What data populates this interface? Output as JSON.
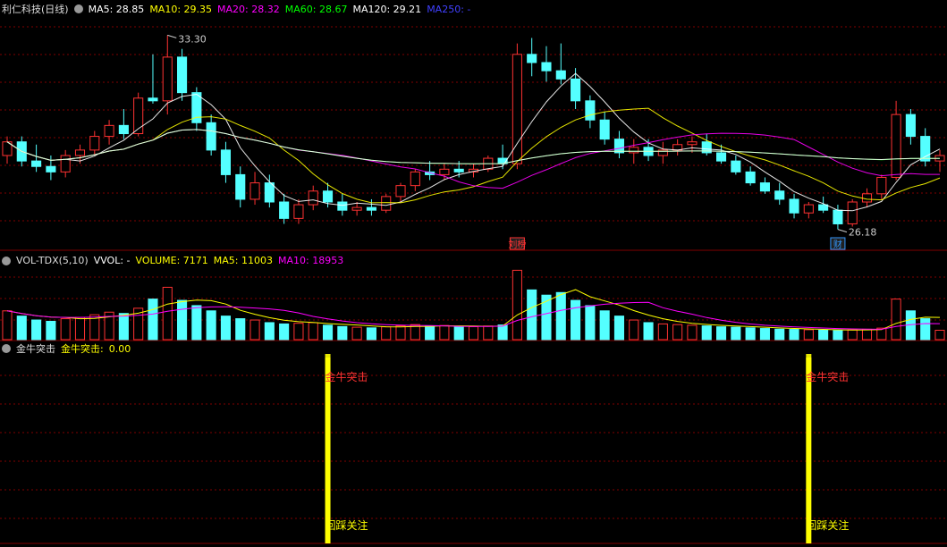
{
  "colors": {
    "up": "#ff3232",
    "down": "#54ffff",
    "ma5": "#ffffff",
    "ma10": "#ffff00",
    "ma20": "#ff00ff",
    "ma60": "#00ff00",
    "ma120": "#ffffff",
    "ma250": "#4040ff",
    "vol_ma5": "#ffff00",
    "vol_ma10": "#ff00ff",
    "bar": "#ffff00",
    "grid": "#800000"
  },
  "price_panel": {
    "title": "利仁科技(日线)",
    "ma_labels": [
      {
        "label": "MA5:",
        "value": "28.85",
        "color": "#ffffff"
      },
      {
        "label": "MA10:",
        "value": "29.35",
        "color": "#ffff00"
      },
      {
        "label": "MA20:",
        "value": "28.32",
        "color": "#ff00ff"
      },
      {
        "label": "MA60:",
        "value": "28.67",
        "color": "#00ff00"
      },
      {
        "label": "MA120:",
        "value": "29.21",
        "color": "#ffffff"
      },
      {
        "label": "MA250:",
        "value": "-",
        "color": "#4040ff"
      }
    ],
    "high_label": "33.30",
    "low_label": "26.18",
    "markers": [
      "刘榜",
      "财"
    ]
  },
  "volume_panel": {
    "title": "VOL-TDX(5,10)",
    "labels": [
      {
        "label": "VVOL:",
        "value": "-",
        "color": "#ffffff"
      },
      {
        "label": "VOLUME:",
        "value": "7171",
        "color": "#ffff00"
      },
      {
        "label": "MA5:",
        "value": "11003",
        "color": "#ffff00"
      },
      {
        "label": "MA10:",
        "value": "18953",
        "color": "#ff00ff"
      }
    ]
  },
  "signal_panel": {
    "title": "金牛突击",
    "label": "金牛突击:",
    "value": "0.00",
    "top_text": "金牛突击",
    "bottom_text": "回踩关注"
  },
  "chart_data": [
    {
      "type": "candlestick",
      "title": "利仁科技(日线)",
      "ylim": [
        25.5,
        34.0
      ],
      "candles": [
        {
          "o": 28.9,
          "h": 29.6,
          "l": 28.6,
          "c": 29.4
        },
        {
          "o": 29.4,
          "h": 29.6,
          "l": 28.5,
          "c": 28.7
        },
        {
          "o": 28.7,
          "h": 29.3,
          "l": 28.3,
          "c": 28.5
        },
        {
          "o": 28.5,
          "h": 28.9,
          "l": 28.0,
          "c": 28.3
        },
        {
          "o": 28.3,
          "h": 29.1,
          "l": 28.1,
          "c": 28.9
        },
        {
          "o": 28.9,
          "h": 29.3,
          "l": 28.6,
          "c": 29.1
        },
        {
          "o": 29.1,
          "h": 29.8,
          "l": 28.9,
          "c": 29.6
        },
        {
          "o": 29.6,
          "h": 30.2,
          "l": 29.3,
          "c": 30.0
        },
        {
          "o": 30.0,
          "h": 30.6,
          "l": 29.5,
          "c": 29.7
        },
        {
          "o": 29.7,
          "h": 31.2,
          "l": 29.6,
          "c": 31.0
        },
        {
          "o": 31.0,
          "h": 32.6,
          "l": 30.8,
          "c": 30.9
        },
        {
          "o": 30.9,
          "h": 33.3,
          "l": 30.4,
          "c": 32.5
        },
        {
          "o": 32.5,
          "h": 32.8,
          "l": 30.9,
          "c": 31.2
        },
        {
          "o": 31.2,
          "h": 31.4,
          "l": 29.8,
          "c": 30.1
        },
        {
          "o": 30.1,
          "h": 30.4,
          "l": 28.9,
          "c": 29.1
        },
        {
          "o": 29.1,
          "h": 29.4,
          "l": 27.9,
          "c": 28.2
        },
        {
          "o": 28.2,
          "h": 28.5,
          "l": 27.0,
          "c": 27.3
        },
        {
          "o": 27.3,
          "h": 28.3,
          "l": 27.1,
          "c": 27.9
        },
        {
          "o": 27.9,
          "h": 28.2,
          "l": 27.0,
          "c": 27.2
        },
        {
          "o": 27.2,
          "h": 27.5,
          "l": 26.4,
          "c": 26.6
        },
        {
          "o": 26.6,
          "h": 27.3,
          "l": 26.4,
          "c": 27.1
        },
        {
          "o": 27.1,
          "h": 27.8,
          "l": 26.9,
          "c": 27.6
        },
        {
          "o": 27.6,
          "h": 27.9,
          "l": 27.0,
          "c": 27.2
        },
        {
          "o": 27.2,
          "h": 27.5,
          "l": 26.7,
          "c": 26.9
        },
        {
          "o": 26.9,
          "h": 27.2,
          "l": 26.7,
          "c": 27.0
        },
        {
          "o": 27.0,
          "h": 27.3,
          "l": 26.7,
          "c": 26.9
        },
        {
          "o": 26.9,
          "h": 27.5,
          "l": 26.8,
          "c": 27.4
        },
        {
          "o": 27.4,
          "h": 27.9,
          "l": 27.2,
          "c": 27.8
        },
        {
          "o": 27.8,
          "h": 28.4,
          "l": 27.6,
          "c": 28.3
        },
        {
          "o": 28.3,
          "h": 28.7,
          "l": 28.0,
          "c": 28.2
        },
        {
          "o": 28.2,
          "h": 28.6,
          "l": 28.0,
          "c": 28.4
        },
        {
          "o": 28.4,
          "h": 28.7,
          "l": 28.1,
          "c": 28.3
        },
        {
          "o": 28.3,
          "h": 28.6,
          "l": 28.1,
          "c": 28.4
        },
        {
          "o": 28.4,
          "h": 28.9,
          "l": 28.3,
          "c": 28.8
        },
        {
          "o": 28.8,
          "h": 29.3,
          "l": 28.4,
          "c": 28.6
        },
        {
          "o": 28.6,
          "h": 33.0,
          "l": 28.4,
          "c": 32.6
        },
        {
          "o": 32.6,
          "h": 33.2,
          "l": 31.8,
          "c": 32.3
        },
        {
          "o": 32.3,
          "h": 32.9,
          "l": 31.6,
          "c": 32.0
        },
        {
          "o": 32.0,
          "h": 33.0,
          "l": 31.5,
          "c": 31.7
        },
        {
          "o": 31.7,
          "h": 32.1,
          "l": 30.6,
          "c": 30.9
        },
        {
          "o": 30.9,
          "h": 31.1,
          "l": 29.9,
          "c": 30.2
        },
        {
          "o": 30.2,
          "h": 30.5,
          "l": 29.3,
          "c": 29.5
        },
        {
          "o": 29.5,
          "h": 29.8,
          "l": 28.8,
          "c": 29.0
        },
        {
          "o": 29.0,
          "h": 29.5,
          "l": 28.6,
          "c": 29.2
        },
        {
          "o": 29.2,
          "h": 29.5,
          "l": 28.7,
          "c": 28.9
        },
        {
          "o": 28.9,
          "h": 29.4,
          "l": 28.6,
          "c": 29.1
        },
        {
          "o": 29.1,
          "h": 29.5,
          "l": 28.9,
          "c": 29.3
        },
        {
          "o": 29.3,
          "h": 29.6,
          "l": 29.0,
          "c": 29.4
        },
        {
          "o": 29.4,
          "h": 29.7,
          "l": 28.9,
          "c": 29.0
        },
        {
          "o": 29.0,
          "h": 29.3,
          "l": 28.6,
          "c": 28.7
        },
        {
          "o": 28.7,
          "h": 28.9,
          "l": 28.2,
          "c": 28.3
        },
        {
          "o": 28.3,
          "h": 28.5,
          "l": 27.8,
          "c": 27.9
        },
        {
          "o": 27.9,
          "h": 28.1,
          "l": 27.5,
          "c": 27.6
        },
        {
          "o": 27.6,
          "h": 27.9,
          "l": 27.1,
          "c": 27.3
        },
        {
          "o": 27.3,
          "h": 27.5,
          "l": 26.6,
          "c": 26.8
        },
        {
          "o": 26.8,
          "h": 27.2,
          "l": 26.6,
          "c": 27.1
        },
        {
          "o": 27.1,
          "h": 27.4,
          "l": 26.8,
          "c": 26.9
        },
        {
          "o": 26.9,
          "h": 27.1,
          "l": 26.2,
          "c": 26.4
        },
        {
          "o": 26.4,
          "h": 27.3,
          "l": 26.3,
          "c": 27.2
        },
        {
          "o": 27.2,
          "h": 27.7,
          "l": 27.0,
          "c": 27.5
        },
        {
          "o": 27.5,
          "h": 28.2,
          "l": 27.3,
          "c": 28.1
        },
        {
          "o": 28.1,
          "h": 30.9,
          "l": 28.0,
          "c": 30.4
        },
        {
          "o": 30.4,
          "h": 30.6,
          "l": 29.3,
          "c": 29.6
        },
        {
          "o": 29.6,
          "h": 29.9,
          "l": 28.5,
          "c": 28.7
        },
        {
          "o": 28.7,
          "h": 29.1,
          "l": 28.3,
          "c": 28.9
        }
      ]
    },
    {
      "type": "bar",
      "title": "VOL-TDX(5,10)",
      "series": [
        {
          "name": "VOLUME",
          "values": [
            22000,
            18000,
            15000,
            14000,
            16000,
            17000,
            19000,
            21000,
            20000,
            24000,
            31000,
            40000,
            30000,
            26000,
            22000,
            18000,
            16000,
            15000,
            13000,
            12000,
            12500,
            13000,
            11000,
            10000,
            9500,
            9000,
            9800,
            10500,
            11500,
            10200,
            10800,
            9600,
            9900,
            10400,
            11200,
            53000,
            38000,
            34000,
            36000,
            30000,
            26000,
            22000,
            18000,
            15000,
            13000,
            12000,
            11500,
            11000,
            10500,
            9800,
            9500,
            9000,
            8500,
            8000,
            7800,
            7600,
            7200,
            7000,
            7400,
            7900,
            8800,
            31000,
            22000,
            16000,
            7171
          ]
        },
        {
          "name": "MA5",
          "values": []
        },
        {
          "name": "MA10",
          "values": []
        }
      ]
    },
    {
      "type": "bar",
      "title": "金牛突击",
      "series": [
        {
          "name": "金牛突击",
          "values": [
            0,
            0,
            0,
            0,
            0,
            0,
            0,
            0,
            0,
            0,
            0,
            0,
            0,
            0,
            0,
            0,
            0,
            0,
            0,
            0,
            0,
            0,
            1,
            0,
            0,
            0,
            0,
            0,
            0,
            0,
            0,
            0,
            0,
            0,
            0,
            0,
            0,
            0,
            0,
            0,
            0,
            0,
            0,
            0,
            0,
            0,
            0,
            0,
            0,
            0,
            0,
            0,
            0,
            0,
            0,
            1,
            0,
            0,
            0,
            0,
            0,
            0,
            0,
            0,
            0
          ]
        }
      ]
    }
  ]
}
